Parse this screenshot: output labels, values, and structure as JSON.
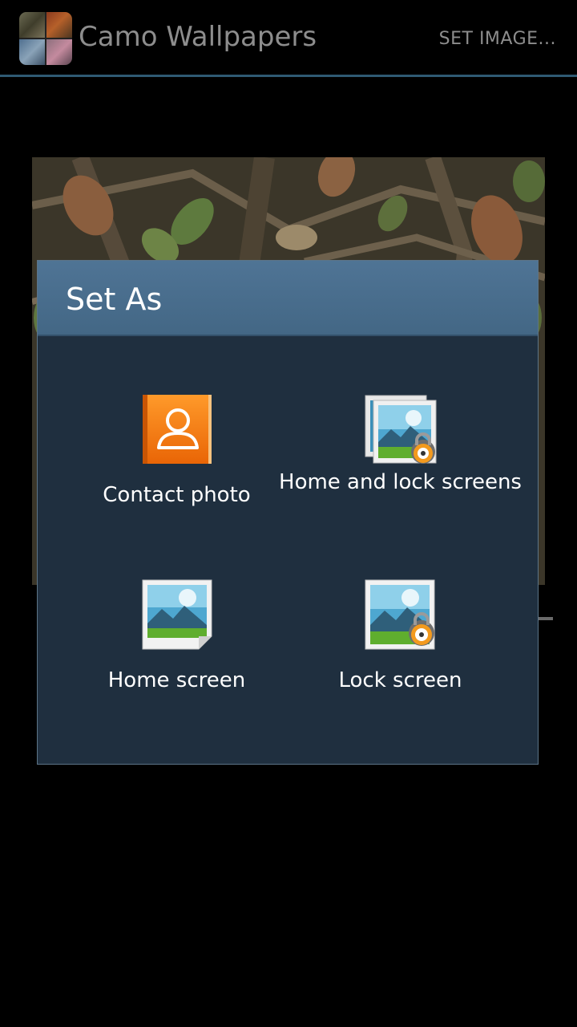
{
  "action_bar": {
    "app_icon": "camo-wallpapers-app-icon",
    "title": "Camo Wallpapers",
    "action_label": "SET IMAGE..."
  },
  "preview": {
    "image": "camo-wallpaper-preview"
  },
  "dialog": {
    "title": "Set As",
    "options": [
      {
        "label": "Contact photo",
        "icon": "contact-photo-icon"
      },
      {
        "label": "Home and lock screens",
        "icon": "home-and-lock-screens-icon"
      },
      {
        "label": "Home screen",
        "icon": "home-screen-icon"
      },
      {
        "label": "Lock screen",
        "icon": "lock-screen-icon"
      }
    ]
  },
  "colors": {
    "action_bar_divider": "#2f5a73",
    "dialog_header": "#4a6e8e",
    "dialog_body": "#1f2f3f",
    "contact_orange": "#f47a12"
  }
}
